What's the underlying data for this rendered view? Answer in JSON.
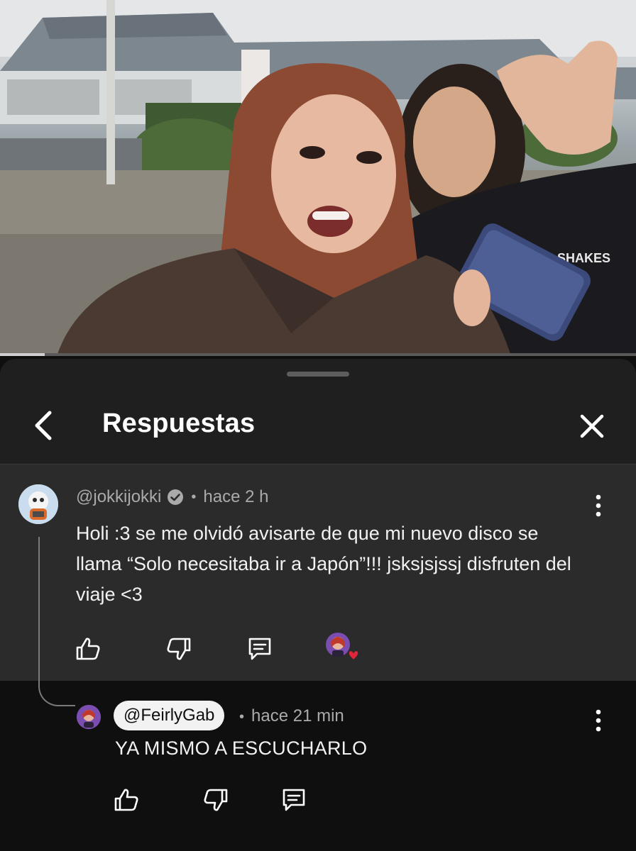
{
  "video": {
    "progress_fraction": 0.07
  },
  "sheet": {
    "title": "Respuestas",
    "back_icon": "chevron-left-icon",
    "close_icon": "close-icon"
  },
  "main_comment": {
    "author": "@jokkijokki",
    "verified": true,
    "time": "hace 2 h",
    "text": "Holi :3 se me olvidó avisarte de que mi nuevo disco se llama “Solo necesitaba ir a Japón”!!! jsksjsjssj disfruten del viaje <3",
    "actions": [
      "like-icon",
      "dislike-icon",
      "reply-icon",
      "creator-heart-icon"
    ]
  },
  "reply": {
    "author": "@FeirlyGab",
    "time": "hace 21 min",
    "text": "YA MISMO A ESCUCHARLO",
    "actions": [
      "like-icon",
      "dislike-icon",
      "reply-icon"
    ]
  },
  "colors": {
    "sheet_bg": "#1f1f1f",
    "highlight_bg": "#2b2b2b",
    "text_primary": "#f1f1f1",
    "text_secondary": "#aaaaaa",
    "heart": "#e0243a"
  }
}
